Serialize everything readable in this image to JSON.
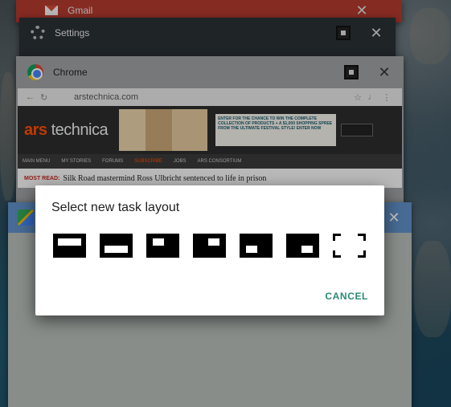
{
  "recents": {
    "gmail": {
      "title": "Gmail",
      "icon": "gmail-icon",
      "color": "#b23a2e"
    },
    "settings": {
      "title": "Settings",
      "icon": "gear-icon"
    },
    "chrome": {
      "title": "Chrome",
      "icon": "chrome-icon",
      "url": "arstechnica.com",
      "site": {
        "logo_prefix": "ars",
        "logo_suffix": "technica",
        "ad_text": "ENTER FOR THE CHANCE TO WIN THE COMPLETE COLLECTION OF PRODUCTS + A $1,000 SHOPPING SPREE FROM THE ULTIMATE FESTIVAL STYLE!",
        "ad_cta": "ENTER NOW",
        "nav": [
          "MAIN MENU",
          "MY STORIES",
          "FORUMS",
          "SUBSCRIBE",
          "JOBS",
          "ARS CONSORTIUM"
        ],
        "headline_tag": "MOST READ:",
        "headline": "Silk Road mastermind Ross Ulbricht sentenced to life in prison"
      }
    },
    "maps": {
      "icon": "maps-icon",
      "color": "#5f8fc6"
    }
  },
  "dialog": {
    "title": "Select new task layout",
    "cancel_label": "CANCEL",
    "layout_options": [
      "layout-top-half-icon",
      "layout-bottom-half-icon",
      "layout-top-left-icon",
      "layout-top-right-icon",
      "layout-bottom-left-icon",
      "layout-bottom-right-icon",
      "layout-fullscreen-icon"
    ],
    "accent_color": "#2b8a77"
  }
}
